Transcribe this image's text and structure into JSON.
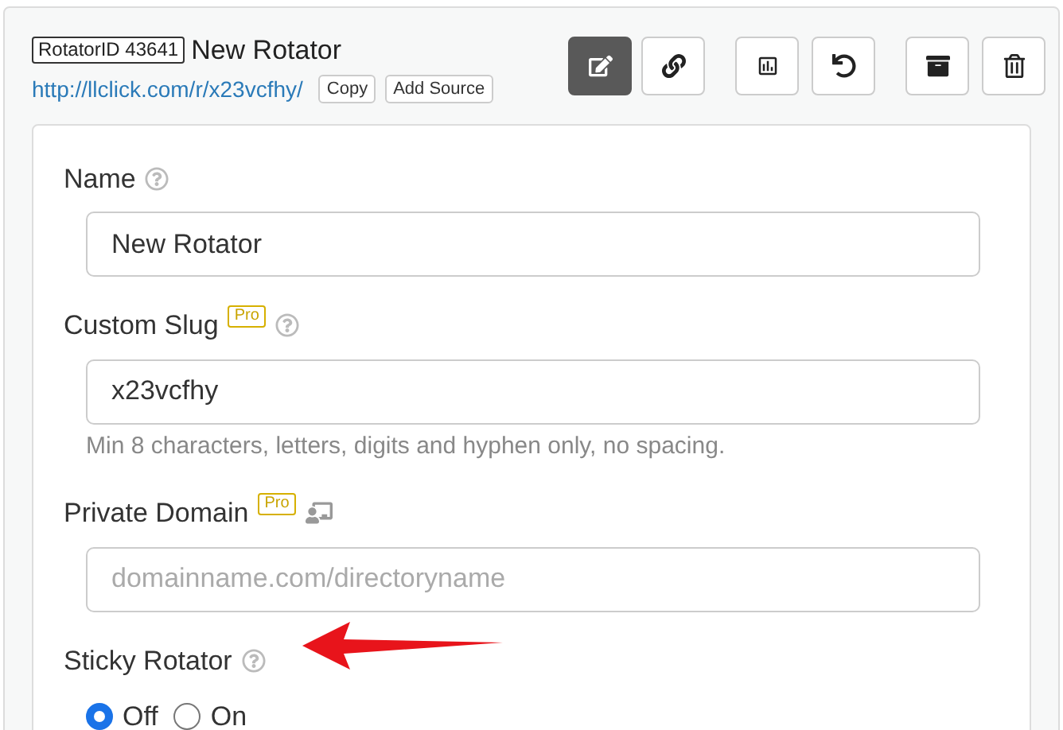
{
  "header": {
    "id_badge": "RotatorID 43641",
    "title": "New Rotator",
    "url": "http://llclick.com/r/x23vcfhy/",
    "link_buttons": [
      "Copy",
      "Add Source"
    ]
  },
  "toolbar": [
    {
      "kind": "edit",
      "selected": true
    },
    {
      "kind": "link",
      "selected": false
    },
    {
      "kind": "stats",
      "selected": false
    },
    {
      "kind": "reset",
      "selected": false
    },
    {
      "kind": "archive",
      "selected": false
    },
    {
      "kind": "delete",
      "selected": false
    }
  ],
  "form": [
    {
      "kind": "text",
      "label": "Name",
      "help": true,
      "value": "New Rotator"
    },
    {
      "kind": "text",
      "label": "Custom Slug",
      "pro": "Pro",
      "help": true,
      "value": "x23vcfhy",
      "hint": "Min 8 characters, letters, digits and hyphen only, no spacing."
    },
    {
      "kind": "text",
      "label": "Private Domain",
      "pro": "Pro",
      "domain_icon": true,
      "placeholder": "domainname.com/directoryname"
    },
    {
      "kind": "radio",
      "label": "Sticky Rotator",
      "help": true,
      "options": [
        {
          "label": "Off",
          "selected": true
        },
        {
          "label": "On",
          "selected": false
        }
      ]
    }
  ]
}
